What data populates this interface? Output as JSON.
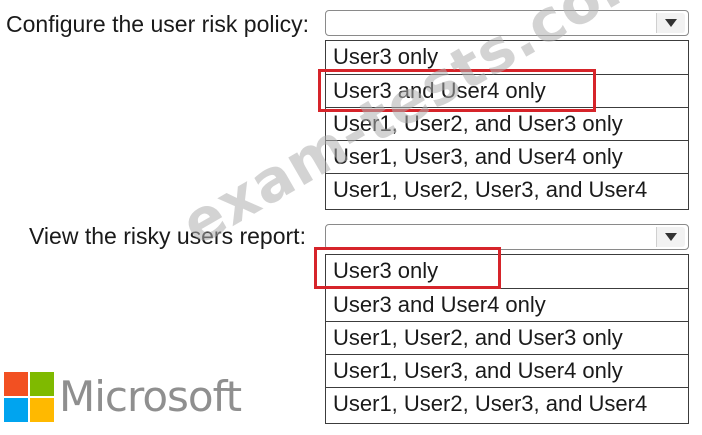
{
  "questions": [
    {
      "label": "Configure the user risk policy:",
      "selected_value": "",
      "options": [
        "User3 only",
        "User3 and User4 only",
        "User1, User2, and User3 only",
        "User1, User3, and User4 only",
        "User1, User2, User3, and User4"
      ],
      "highlighted_option": "User3 and User4 only"
    },
    {
      "label": "View the risky users report:",
      "selected_value": "",
      "options": [
        "User3 only",
        "User3 and User4 only",
        "User1, User2, and User3 only",
        "User1, User3, and User4 only",
        "User1, User2, User3, and User4"
      ],
      "highlighted_option": "User3 only"
    }
  ],
  "watermark": "exam-tests.com",
  "logo": {
    "wordmark": "Microsoft",
    "colors": {
      "red": "#f25022",
      "green": "#7fba00",
      "blue": "#00a4ef",
      "yellow": "#ffb900"
    }
  },
  "colors": {
    "highlight_border": "#d6242a",
    "text": "#1a1a1a",
    "watermark": "#afafaf"
  },
  "icons": {
    "dropdown": "chevron-down-icon"
  }
}
